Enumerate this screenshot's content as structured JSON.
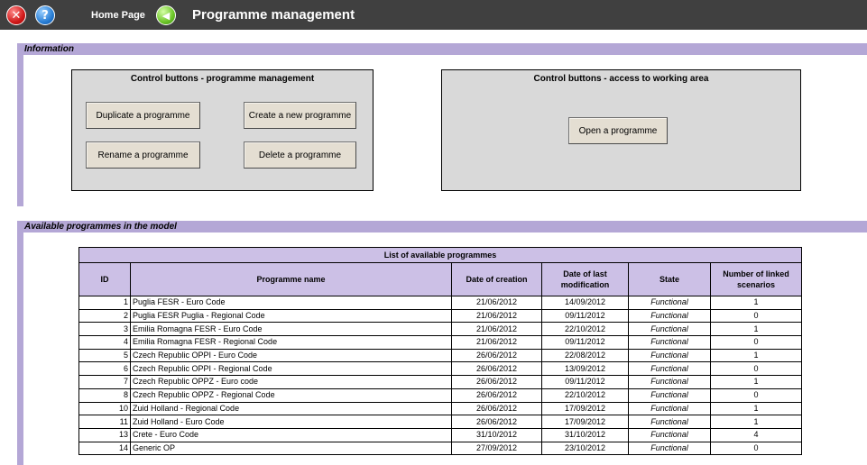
{
  "header": {
    "close_icon": "close-icon",
    "help_icon": "help-icon",
    "home_label": "Home Page",
    "back_icon": "back-arrow-icon",
    "title": "Programme management"
  },
  "information": {
    "section_label": "Information",
    "management_panel": {
      "title": "Control buttons  - programme management",
      "duplicate_label": "Duplicate a programme",
      "create_label": "Create a new programme",
      "rename_label": "Rename a programme",
      "delete_label": "Delete a programme"
    },
    "access_panel": {
      "title": "Control buttons  - access to working area",
      "open_label": "Open a programme"
    }
  },
  "programmes": {
    "section_label": "Available programmes in the model",
    "table_caption": "List of available programmes",
    "columns": [
      "ID",
      "Programme name",
      "Date of creation",
      "Date of last modification",
      "State",
      "Number of linked scenarios"
    ],
    "rows": [
      {
        "id": "1",
        "name": "Puglia FESR - Euro Code",
        "created": "21/06/2012",
        "modified": "14/09/2012",
        "state": "Functional",
        "scenarios": "1"
      },
      {
        "id": "2",
        "name": "Puglia FESR Puglia - Regional Code",
        "created": "21/06/2012",
        "modified": "09/11/2012",
        "state": "Functional",
        "scenarios": "0"
      },
      {
        "id": "3",
        "name": "Emilia Romagna FESR - Euro Code",
        "created": "21/06/2012",
        "modified": "22/10/2012",
        "state": "Functional",
        "scenarios": "1"
      },
      {
        "id": "4",
        "name": "Emilia Romagna FESR - Regional Code",
        "created": "21/06/2012",
        "modified": "09/11/2012",
        "state": "Functional",
        "scenarios": "0"
      },
      {
        "id": "5",
        "name": "Czech Republic OPPI - Euro Code",
        "created": "26/06/2012",
        "modified": "22/08/2012",
        "state": "Functional",
        "scenarios": "1"
      },
      {
        "id": "6",
        "name": "Czech Republic OPPI - Regional Code",
        "created": "26/06/2012",
        "modified": "13/09/2012",
        "state": "Functional",
        "scenarios": "0"
      },
      {
        "id": "7",
        "name": "Czech Republic OPPZ - Euro code",
        "created": "26/06/2012",
        "modified": "09/11/2012",
        "state": "Functional",
        "scenarios": "1"
      },
      {
        "id": "8",
        "name": "Czech Republic OPPZ - Regional Code",
        "created": "26/06/2012",
        "modified": "22/10/2012",
        "state": "Functional",
        "scenarios": "0"
      },
      {
        "id": "10",
        "name": "Zuid Holland - Regional Code",
        "created": "26/06/2012",
        "modified": "17/09/2012",
        "state": "Functional",
        "scenarios": "1"
      },
      {
        "id": "11",
        "name": "Zuid Holland - Euro Code",
        "created": "26/06/2012",
        "modified": "17/09/2012",
        "state": "Functional",
        "scenarios": "1"
      },
      {
        "id": "13",
        "name": "Crete - Euro Code",
        "created": "31/10/2012",
        "modified": "31/10/2012",
        "state": "Functional",
        "scenarios": "4"
      },
      {
        "id": "14",
        "name": "Generic OP",
        "created": "27/09/2012",
        "modified": "23/10/2012",
        "state": "Functional",
        "scenarios": "0"
      }
    ]
  }
}
